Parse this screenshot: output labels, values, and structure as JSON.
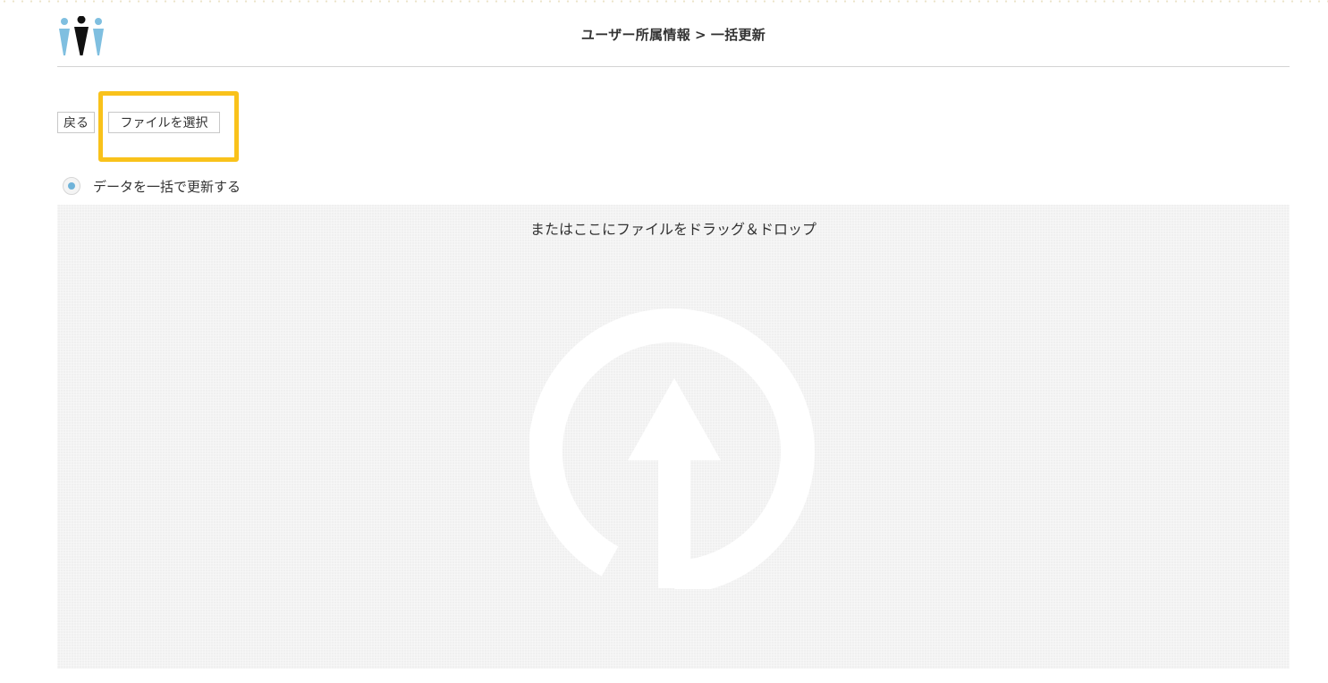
{
  "header": {
    "title_part1": "ユーザー所属情報",
    "separator": ">",
    "title_part2": "一括更新",
    "logo_icon": "people-logo-icon"
  },
  "toolbar": {
    "back_label": "戻る",
    "choose_file_label": "ファイルを選択"
  },
  "options": {
    "bulk_update_label": "データを一括で更新する",
    "bulk_update_selected": true
  },
  "dropzone": {
    "text": "またはここにファイルをドラッグ＆ドロップ",
    "icon": "upload-arrow-icon"
  },
  "colors": {
    "accent": "#6fb3d9",
    "highlight": "#f9c21b",
    "logo_dark": "#111111",
    "logo_light": "#7fbfe0",
    "dropzone_bg": "#f0f0f0"
  }
}
